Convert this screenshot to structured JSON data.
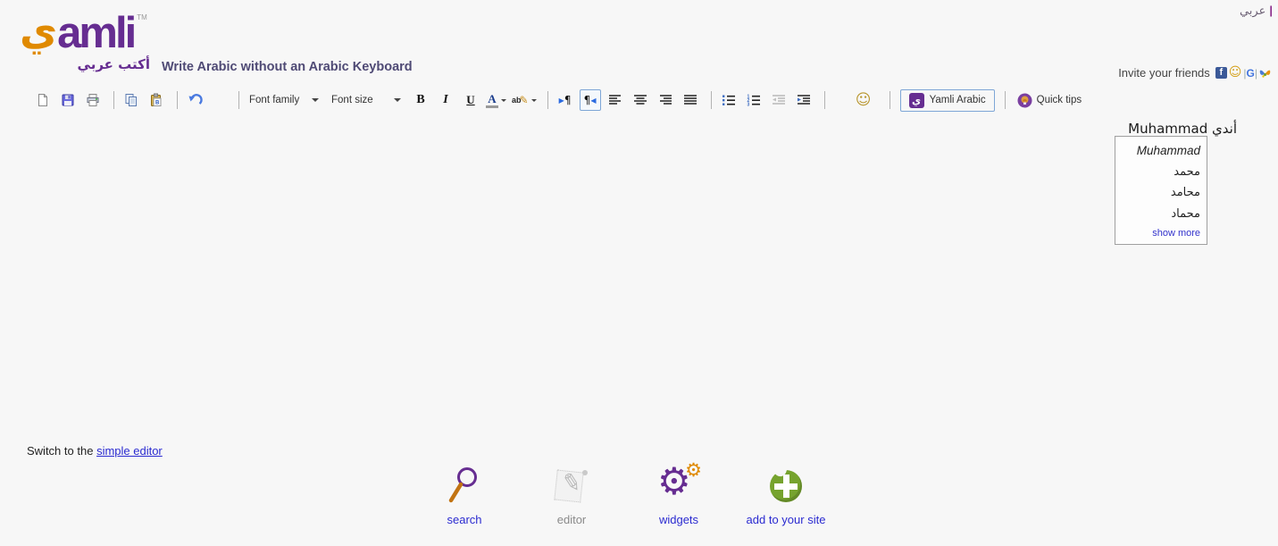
{
  "colors": {
    "brand_purple": "#662d91",
    "brand_orange": "#e08a00",
    "link_blue": "#2a2ad0",
    "selected_border": "#7ea6d6",
    "page_bg": "#f7f7f7"
  },
  "header": {
    "language_link": "عربي",
    "language_separator": "|",
    "logo": {
      "ya": "ي",
      "word": "amli",
      "tm": "TM",
      "subtitle": "أكتب عربي"
    },
    "tagline": "Write Arabic without an Arabic Keyboard",
    "invite_label": "Invite your friends",
    "social": {
      "facebook_glyph": "f",
      "yahoo_glyph": "☺",
      "google_g": "G",
      "google_pipe": "|"
    }
  },
  "toolbar": {
    "font_family_label": "Font family",
    "font_size_label": "Font size",
    "bold_label": "B",
    "italic_label": "I",
    "underline_label": "U",
    "font_color_label": "A",
    "highlight_label": "ab",
    "highlight_pen_glyph": "✎",
    "pilcrow": "¶",
    "ltr_arrow": "▶",
    "rtl_arrow": "◀",
    "smiley_glyph": "☺",
    "yamli_icon_glyph": "ي",
    "yamli_button_label": "Yamli Arabic",
    "quick_tips_label": "Quick tips"
  },
  "editor": {
    "content_latin": "Muhammad",
    "content_arabic": "أندي",
    "suggestions": {
      "items": [
        {
          "label": "Muhammad"
        },
        {
          "label": "محمد"
        },
        {
          "label": "محامد"
        },
        {
          "label": "محماد"
        }
      ],
      "show_more_label": "show more"
    }
  },
  "footer": {
    "switch_prefix": "Switch to the",
    "switch_link": "simple editor",
    "nav": [
      {
        "label": "search"
      },
      {
        "label": "editor"
      },
      {
        "label": "widgets"
      },
      {
        "label": "add to your site"
      }
    ],
    "gear_glyph": "⚙",
    "pencil_glyph": "✎"
  }
}
